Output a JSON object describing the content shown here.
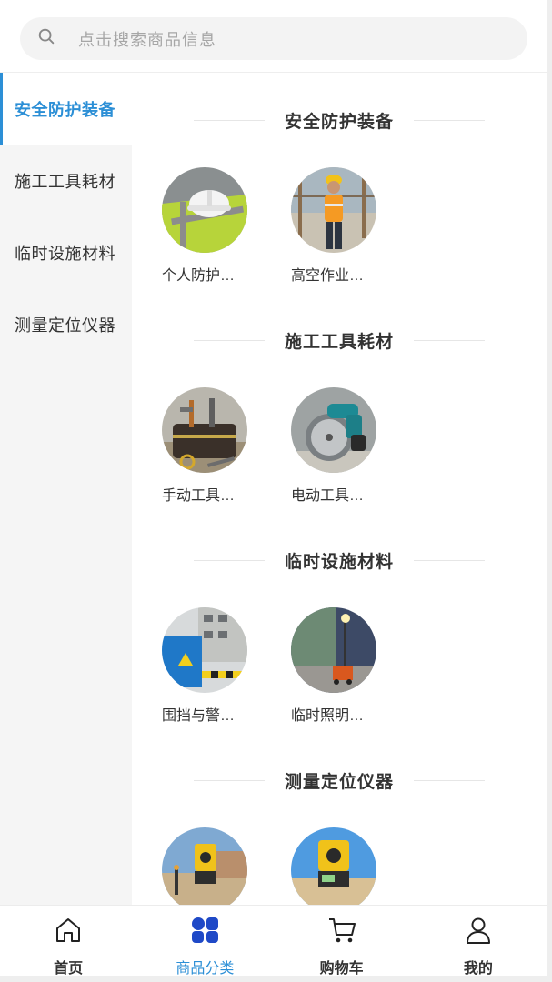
{
  "search": {
    "placeholder": "点击搜索商品信息",
    "icon": "search-icon"
  },
  "sidebar": {
    "items": [
      {
        "label": "安全防护装备",
        "active": true
      },
      {
        "label": "施工工具耗材",
        "active": false
      },
      {
        "label": "临时设施材料",
        "active": false
      },
      {
        "label": "测量定位仪器",
        "active": false
      }
    ]
  },
  "sections": [
    {
      "title": "安全防护装备",
      "products": [
        {
          "name": "个人防护…"
        },
        {
          "name": "高空作业…"
        }
      ]
    },
    {
      "title": "施工工具耗材",
      "products": [
        {
          "name": "手动工具…"
        },
        {
          "name": "电动工具…"
        }
      ]
    },
    {
      "title": "临时设施材料",
      "products": [
        {
          "name": "围挡与警…"
        },
        {
          "name": "临时照明…"
        }
      ]
    },
    {
      "title": "测量定位仪器",
      "products": [
        {
          "name": ""
        },
        {
          "name": ""
        }
      ]
    }
  ],
  "tabbar": {
    "tabs": [
      {
        "label": "首页",
        "icon": "home-icon",
        "active": false
      },
      {
        "label": "商品分类",
        "icon": "category-icon",
        "active": true
      },
      {
        "label": "购物车",
        "icon": "cart-icon",
        "active": false
      },
      {
        "label": "我的",
        "icon": "user-icon",
        "active": false
      }
    ]
  },
  "colors": {
    "accent": "#2c8fd6",
    "category_icon": "#1f49c7",
    "nav_bg": "#f5f5f5"
  }
}
